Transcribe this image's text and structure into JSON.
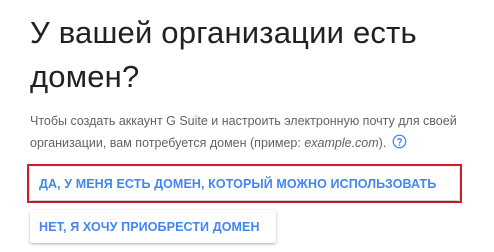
{
  "page": {
    "heading": "У вашей организации есть домен?",
    "description_main": "Чтобы создать аккаунт G Suite и настроить электронную почту для своей организации, вам потребуется домен (пример: ",
    "description_example": "example.com",
    "description_end": ")."
  },
  "actions": {
    "yes_label": "ДА, У МЕНЯ ЕСТЬ ДОМЕН, КОТОРЫЙ МОЖНО ИСПОЛЬЗОВАТЬ",
    "no_label": "НЕТ, Я ХОЧУ ПРИОБРЕСТИ ДОМЕН"
  },
  "icons": {
    "help": "help-circle-icon"
  },
  "colors": {
    "accent": "#4285f4",
    "highlight": "#d51f28",
    "heading_text": "#212121",
    "body_text": "#5f6368"
  }
}
